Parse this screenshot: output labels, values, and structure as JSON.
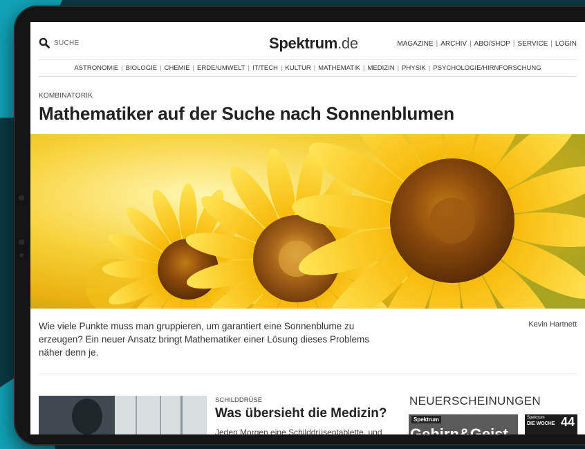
{
  "colors": {
    "background": "#0b3a44",
    "accent_teal": "#12a3b8",
    "text_dark": "#222222"
  },
  "header": {
    "search_label": "SUCHE",
    "logo_bold": "Spektrum",
    "logo_suffix": ".de",
    "top_nav": [
      "MAGAZINE",
      "ARCHIV",
      "ABO/SHOP",
      "SERVICE",
      "LOGIN"
    ]
  },
  "categories": [
    "ASTRONOMIE",
    "BIOLOGIE",
    "CHEMIE",
    "ERDE/UMWELT",
    "IT/TECH",
    "KULTUR",
    "MATHEMATIK",
    "MEDIZIN",
    "PHYSIK",
    "PSYCHOLOGIE/HIRNFORSCHUNG"
  ],
  "article": {
    "kicker": "KOMBINATORIK",
    "title": "Mathematiker auf der Suche nach Sonnenblumen",
    "hero_icon": "sunflower-photo",
    "teaser": "Wie viele Punkte muss man gruppieren, um garantiert eine Sonnenblume zu erzeugen? Ein neuer Ansatz bringt Mathematiker einer Lösung dieses Problems näher denn je.",
    "author": "Kevin Hartnett"
  },
  "card": {
    "kicker": "SCHILDDRÜSE",
    "title": "Was übersieht die Medizin?",
    "text": "Jeden Morgen eine Schilddrüsentablette, und"
  },
  "sidebar": {
    "title": "NEUERSCHEINUNGEN",
    "mag1_brand": "Spektrum",
    "mag1_title": "Gehirn&Geist",
    "mag2_brand": "Spektrum",
    "mag2_sub": "DIE WOCHE",
    "mag2_number": "44"
  }
}
